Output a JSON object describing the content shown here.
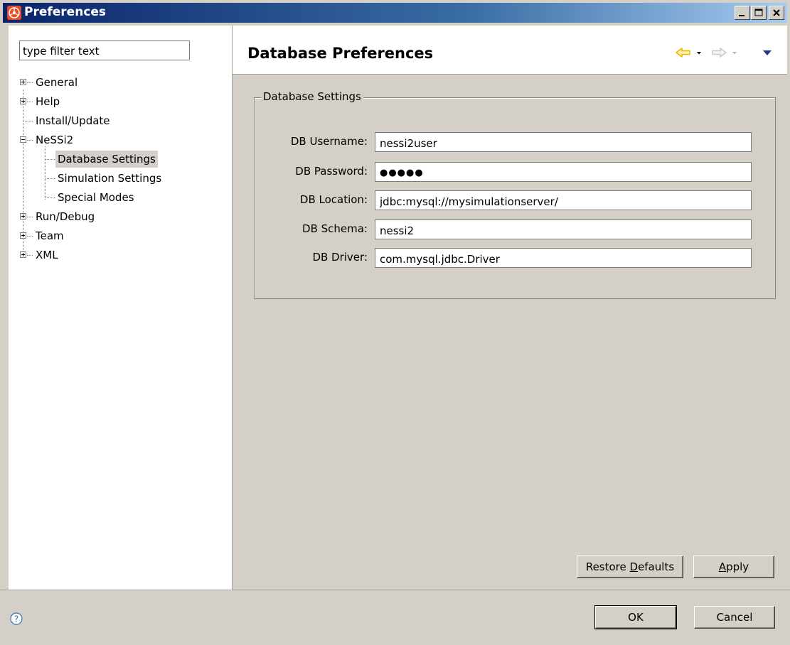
{
  "window": {
    "title": "Preferences"
  },
  "filter": {
    "value": "type filter text"
  },
  "tree": {
    "items": [
      {
        "label": "General",
        "expander": "plus",
        "level": 0
      },
      {
        "label": "Help",
        "expander": "plus",
        "level": 0
      },
      {
        "label": "Install/Update",
        "expander": "none",
        "level": 0
      },
      {
        "label": "NeSSi2",
        "expander": "minus",
        "level": 0
      },
      {
        "label": "Database Settings",
        "expander": "none",
        "level": 1,
        "selected": true
      },
      {
        "label": "Simulation Settings",
        "expander": "none",
        "level": 1
      },
      {
        "label": "Special Modes",
        "expander": "none",
        "level": 1
      },
      {
        "label": "Run/Debug",
        "expander": "plus",
        "level": 0
      },
      {
        "label": "Team",
        "expander": "plus",
        "level": 0
      },
      {
        "label": "XML",
        "expander": "plus",
        "level": 0
      }
    ]
  },
  "page": {
    "title": "Database Preferences"
  },
  "settings": {
    "group_title": "Database Settings",
    "fields": [
      {
        "label": "DB Username:",
        "value": "nessi2user"
      },
      {
        "label": "DB Password:",
        "value": "●●●●●"
      },
      {
        "label": "DB Location:",
        "value": "jdbc:mysql://mysimulationserver/"
      },
      {
        "label": "DB Schema:",
        "value": "nessi2"
      },
      {
        "label": "DB Driver:",
        "value": "com.mysql.jdbc.Driver"
      }
    ]
  },
  "buttons": {
    "restore_defaults_pre": "Restore ",
    "restore_defaults_mn": "D",
    "restore_defaults_post": "efaults",
    "apply_mn": "A",
    "apply_post": "pply",
    "ok": "OK",
    "cancel": "Cancel"
  },
  "icons": {
    "app": "app-logo-icon",
    "back": "back-arrow-icon",
    "forward": "forward-arrow-icon",
    "menu": "view-menu-icon",
    "help": "help-icon"
  },
  "colors": {
    "titlebar_start": "#0a246a",
    "titlebar_end": "#a6caf0",
    "face": "#d4d0c8",
    "back_arrow": "#f0b400"
  }
}
